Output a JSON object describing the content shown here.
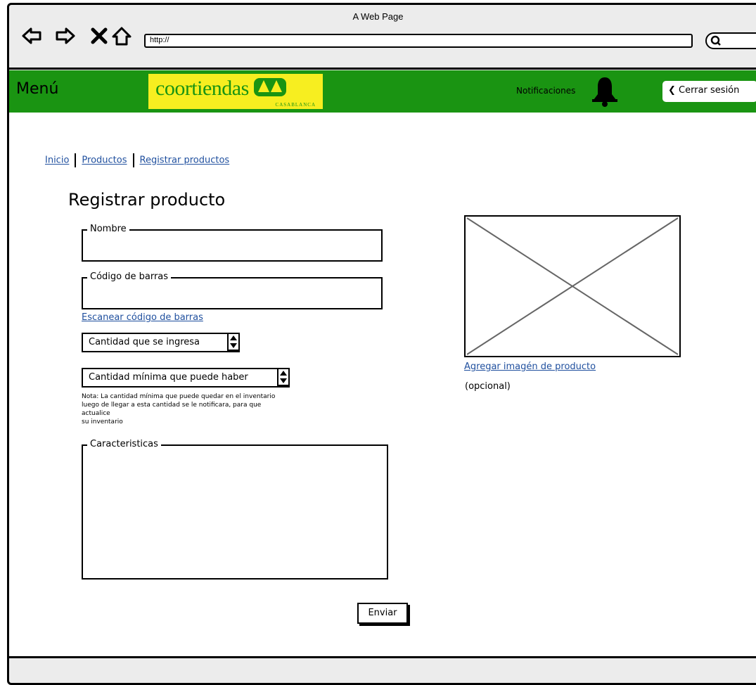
{
  "browser": {
    "window_title": "A Web Page",
    "url": "http://",
    "nav_icons": [
      "back-arrow-icon",
      "forward-arrow-icon",
      "close-x-icon",
      "home-icon"
    ]
  },
  "header": {
    "menu_label": "Menú",
    "logo_text": "coortiendas",
    "logo_subtext": "CASABLANCA",
    "notifications_label": "Notificaciones",
    "logout_label": "Cerrar sesión",
    "colors": {
      "header_bg": "#1a9412",
      "logo_bg": "#f7ee20",
      "logo_accent": "#e0201b"
    }
  },
  "breadcrumb": [
    "Inicio",
    "Productos",
    "Registrar productos"
  ],
  "form": {
    "title": "Registrar producto",
    "name_label": "Nombre",
    "name_value": "",
    "barcode_label": "Código de barras",
    "barcode_value": "",
    "scan_link": "Escanear código de barras",
    "quantity_select": "Cantidad que se ingresa",
    "min_quantity_select": "Cantidad mínima que puede haber",
    "note_lines": [
      "Nota: La cantidad mínima que puede quedar en el inventario",
      "luego de llegar a esta cantidad se le notificara, para que",
      "actualice",
      "su inventario"
    ],
    "characteristics_label": "Caracteristicas",
    "characteristics_value": "",
    "submit_label": "Enviar"
  },
  "image_panel": {
    "add_image_link": "Agregar imagén de producto",
    "optional_text": "(opcional)"
  }
}
